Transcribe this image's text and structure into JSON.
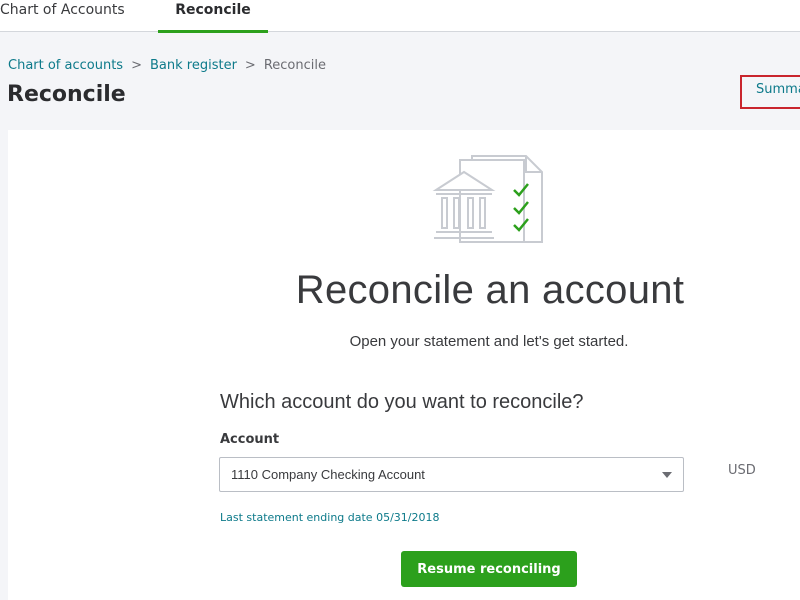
{
  "tabs": [
    {
      "label": "Chart of Accounts"
    },
    {
      "label": "Reconcile"
    }
  ],
  "breadcrumb": {
    "items": [
      "Chart of accounts",
      "Bank register",
      "Reconcile"
    ],
    "separator": ">"
  },
  "page": {
    "title": "Reconcile",
    "summary_link": "Summary"
  },
  "hero": {
    "title": "Reconcile an account",
    "subtitle": "Open your statement and let's get started."
  },
  "form": {
    "question": "Which account do you want to reconcile?",
    "account_label": "Account",
    "account_value": "1110 Company Checking Account",
    "currency": "USD",
    "last_statement": "Last statement ending date 05/31/2018",
    "resume_button": "Resume reconciling"
  },
  "icons": {
    "illustration": "bank-statement-checklist-icon",
    "select": "chevron-down-icon"
  },
  "colors": {
    "accent_green": "#2ca01c",
    "link_teal": "#0d7a8a",
    "highlight_red": "#c9252d"
  }
}
